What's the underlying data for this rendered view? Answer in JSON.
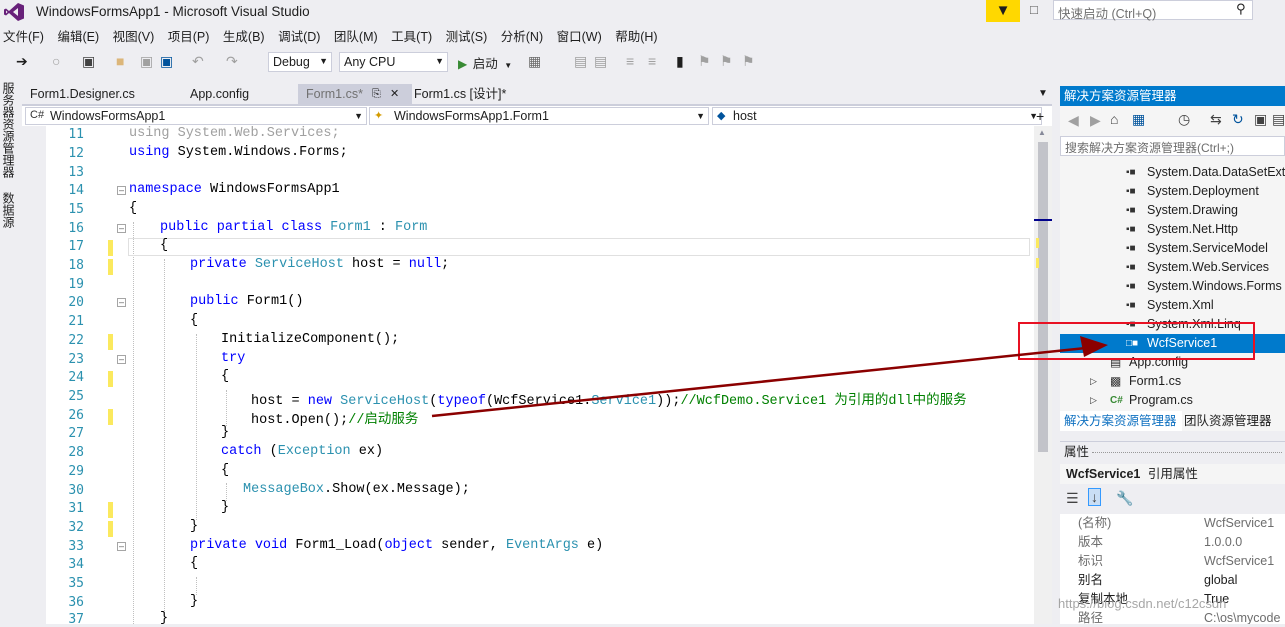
{
  "window": {
    "title": "WindowsFormsApp1 - Microsoft Visual Studio",
    "quick_launch_placeholder": "快速启动 (Ctrl+Q)"
  },
  "menu": [
    "文件(F)",
    "编辑(E)",
    "视图(V)",
    "项目(P)",
    "生成(B)",
    "调试(D)",
    "团队(M)",
    "工具(T)",
    "测试(S)",
    "分析(N)",
    "窗口(W)",
    "帮助(H)"
  ],
  "toolbar": {
    "config": "Debug",
    "platform": "Any CPU",
    "start_label": "启动"
  },
  "left_strip": {
    "server_explorer": "服务器资源管理器",
    "data_sources": "数据源"
  },
  "doc_tabs": [
    {
      "label": "Form1.Designer.cs",
      "active": false
    },
    {
      "label": "App.config",
      "active": false
    },
    {
      "label": "Form1.cs*",
      "active": true
    },
    {
      "label": "Form1.cs [设计]*",
      "active": false
    }
  ],
  "nav": {
    "project": "WindowsFormsApp1",
    "class": "WindowsFormsApp1.Form1",
    "member": "host"
  },
  "code_lines": [
    {
      "n": "11",
      "text": "using System.Web.Services;"
    },
    {
      "n": "12",
      "text": "using System.Windows.Forms;"
    },
    {
      "n": "13",
      "text": ""
    },
    {
      "n": "14",
      "text": "namespace WindowsFormsApp1"
    },
    {
      "n": "15",
      "text": "{"
    },
    {
      "n": "16",
      "text": "public partial class Form1 : Form"
    },
    {
      "n": "17",
      "text": "{"
    },
    {
      "n": "18",
      "text": "private ServiceHost host = null;"
    },
    {
      "n": "19",
      "text": ""
    },
    {
      "n": "20",
      "text": "public Form1()"
    },
    {
      "n": "21",
      "text": "{"
    },
    {
      "n": "22",
      "text": "InitializeComponent();"
    },
    {
      "n": "23",
      "text": "try"
    },
    {
      "n": "24",
      "text": "{"
    },
    {
      "n": "25",
      "text": "host = new ServiceHost(typeof(WcfService1.Service1));//WcfDemo.Service1 为引用的dll中的服务"
    },
    {
      "n": "26",
      "text": "host.Open();//启动服务"
    },
    {
      "n": "27",
      "text": "}"
    },
    {
      "n": "28",
      "text": "catch (Exception ex)"
    },
    {
      "n": "29",
      "text": "{"
    },
    {
      "n": "30",
      "text": "MessageBox.Show(ex.Message);"
    },
    {
      "n": "31",
      "text": "}"
    },
    {
      "n": "32",
      "text": "}"
    },
    {
      "n": "33",
      "text": "private void Form1_Load(object sender, EventArgs e)"
    },
    {
      "n": "34",
      "text": "{"
    },
    {
      "n": "35",
      "text": ""
    },
    {
      "n": "36",
      "text": "}"
    },
    {
      "n": "37",
      "text": "}"
    }
  ],
  "solution_explorer": {
    "title": "解决方案资源管理器",
    "search_placeholder": "搜索解决方案资源管理器(Ctrl+;)",
    "items": [
      {
        "label": "System.Data.DataSetExtensions",
        "kind": "reference"
      },
      {
        "label": "System.Deployment",
        "kind": "reference"
      },
      {
        "label": "System.Drawing",
        "kind": "reference"
      },
      {
        "label": "System.Net.Http",
        "kind": "reference"
      },
      {
        "label": "System.ServiceModel",
        "kind": "reference"
      },
      {
        "label": "System.Web.Services",
        "kind": "reference"
      },
      {
        "label": "System.Windows.Forms",
        "kind": "reference"
      },
      {
        "label": "System.Xml",
        "kind": "reference"
      },
      {
        "label": "System.Xml.Linq",
        "kind": "reference"
      },
      {
        "label": "WcfService1",
        "kind": "reference",
        "selected": true
      },
      {
        "label": "App.config",
        "kind": "config"
      },
      {
        "label": "Form1.cs",
        "kind": "form"
      },
      {
        "label": "Program.cs",
        "kind": "csharp"
      }
    ],
    "tabs": [
      "解决方案资源管理器",
      "团队资源管理器"
    ]
  },
  "properties": {
    "title": "属性",
    "object_name": "WcfService1",
    "object_type": "引用属性",
    "rows": [
      {
        "name": "(名称)",
        "value": "WcfService1",
        "readonly": true
      },
      {
        "name": "版本",
        "value": "1.0.0.0",
        "readonly": true
      },
      {
        "name": "标识",
        "value": "WcfService1",
        "readonly": true
      },
      {
        "name": "别名",
        "value": "global",
        "readonly": false
      },
      {
        "name": "复制本地",
        "value": "True",
        "readonly": false
      },
      {
        "name": "路径",
        "value": "C:\\os\\mycode",
        "readonly": true
      }
    ]
  },
  "watermark": "https://blog.csdn.net/c12csdn",
  "colors": {
    "accent": "#007acc",
    "annotation_red": "#e81123",
    "arrow": "#8b0000",
    "change_marker": "#fbe95e"
  }
}
